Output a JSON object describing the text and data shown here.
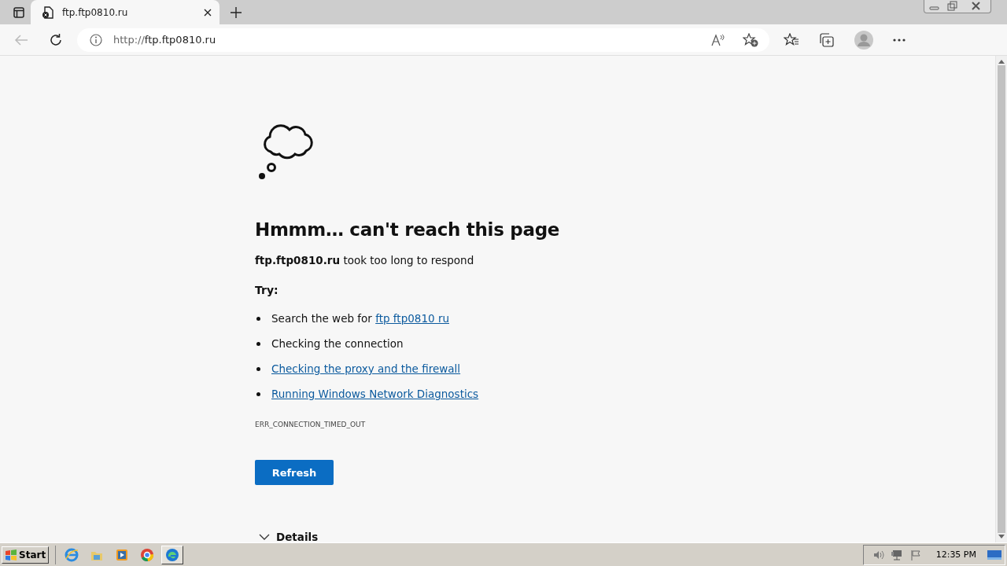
{
  "browser": {
    "tab": {
      "title": "ftp.ftp0810.ru",
      "selected": true
    },
    "address": "http://ftp.ftp0810.ru"
  },
  "page": {
    "heading": "Hmmm… can't reach this page",
    "message": "**ftp.ftp0810.ru** took too long to respond",
    "try_label": "Try:",
    "suggestions": [
      {
        "kind": "text_link",
        "text": "Search the web for ",
        "link": "ftp ftp0810 ru"
      },
      {
        "kind": "plain",
        "text": "Checking the connection"
      },
      {
        "kind": "link",
        "link": "Checking the proxy and the firewall"
      },
      {
        "kind": "link",
        "link": "Running Windows Network Diagnostics"
      }
    ],
    "error_code": "ERR_CONNECTION_TIMED_OUT",
    "button": "Refresh",
    "details": {
      "label": "Details",
      "expanded": false
    }
  },
  "taskbar": {
    "start": "Start",
    "apps": [
      {
        "kind": "ie",
        "active": false
      },
      {
        "kind": "folder",
        "active": false
      },
      {
        "kind": "media",
        "active": false
      },
      {
        "kind": "chrome",
        "active": false
      },
      {
        "kind": "edge",
        "active": true
      }
    ],
    "clock": "12:35 PM"
  }
}
